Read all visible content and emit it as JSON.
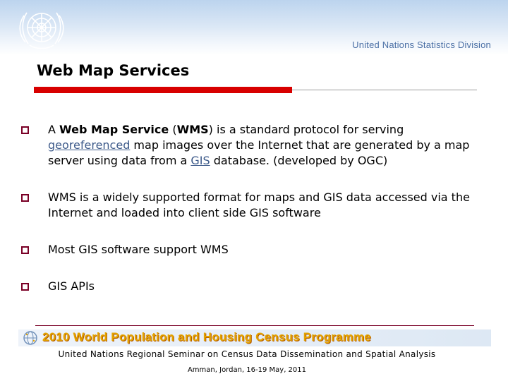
{
  "header": {
    "division_name": "United Nations Statistics Division",
    "band_color": "#bcd4ee",
    "logo_icon": "un-emblem-icon"
  },
  "slide": {
    "title": "Web Map Services",
    "accent_color": "#d80000"
  },
  "bullets": [
    {
      "icon": "checkbox-bullet-icon",
      "parts": {
        "p1": "A ",
        "b1": "Web Map Service",
        "p2": " (",
        "b2": "WMS",
        "p3": ") is a standard protocol for serving ",
        "link1": "georeferenced",
        "p4": " map images over the Internet that are generated by a map server using data from a ",
        "link2": "GIS",
        "p5": " database. (developed by OGC)"
      }
    },
    {
      "icon": "checkbox-bullet-icon",
      "text": "WMS is a widely supported format for maps and GIS data accessed via the Internet and loaded into client side GIS software"
    },
    {
      "icon": "checkbox-bullet-icon",
      "text": "Most GIS software support WMS"
    },
    {
      "icon": "checkbox-bullet-icon",
      "text": "GIS APIs"
    }
  ],
  "footer": {
    "banner_text": "2010 World Population and Housing Census Programme",
    "banner_logo_icon": "census-globe-icon",
    "seminar": "United Nations Regional Seminar on Census Data Dissemination and Spatial Analysis",
    "venue": "Amman, Jordan, 16-19 May, 2011"
  }
}
